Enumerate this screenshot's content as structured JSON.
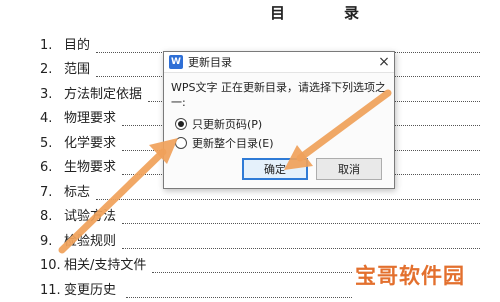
{
  "document": {
    "title": "目　录",
    "toc": [
      {
        "num": "1.",
        "label": "目的"
      },
      {
        "num": "2.",
        "label": "范围"
      },
      {
        "num": "3.",
        "label": "方法制定依据"
      },
      {
        "num": "4.",
        "label": "物理要求"
      },
      {
        "num": "5.",
        "label": "化学要求"
      },
      {
        "num": "6.",
        "label": "生物要求"
      },
      {
        "num": "7.",
        "label": "标志"
      },
      {
        "num": "8.",
        "label": "试验方法"
      },
      {
        "num": "9.",
        "label": "检验规则"
      },
      {
        "num": "10.",
        "label": "相关/支持文件"
      },
      {
        "num": "11.",
        "label": "变更历史"
      }
    ]
  },
  "dialog": {
    "app_icon_letter": "W",
    "title": "更新目录",
    "close_glyph": "×",
    "message": "WPS文字 正在更新目录，请选择下列选项之一:",
    "options": [
      {
        "label": "只更新页码(P)",
        "selected": true
      },
      {
        "label": "更新整个目录(E)",
        "selected": false
      }
    ],
    "ok_label": "确定",
    "cancel_label": "取消"
  },
  "annotation": {
    "arrow_color": "#f0a15a"
  },
  "watermark": {
    "text": "宝哥软件园"
  }
}
